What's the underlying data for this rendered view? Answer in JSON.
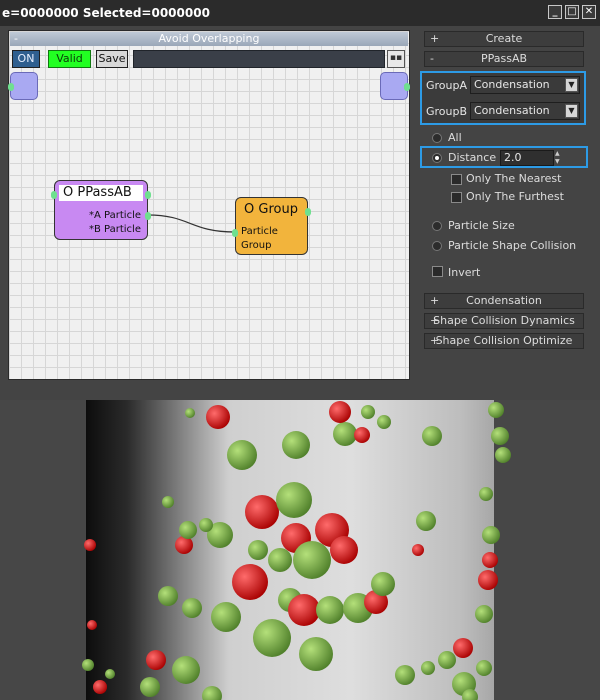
{
  "window": {
    "title": "e=0000000  Selected=0000000",
    "buttons": {
      "minimize": "_",
      "maximize": "□",
      "close": "✕"
    }
  },
  "graph": {
    "header_title": "Avoid Overlapping",
    "header_toggle": "-",
    "toolbar": {
      "on_label": "ON",
      "valid_label": "Valid",
      "save_label": "Save",
      "dots_label": "▪▪"
    },
    "nodes": {
      "ppass": {
        "title": "O PPassAB",
        "ports": [
          "*A Particle",
          "*B Particle"
        ]
      },
      "group": {
        "title": "O Group",
        "ports": [
          "Particle",
          "Group"
        ]
      }
    },
    "colors": {
      "ppass_node": "#c889f2",
      "group_node": "#f2b43c",
      "valid": "#22ff22"
    }
  },
  "panel": {
    "create_label": "Create",
    "create_sign": "+",
    "ppass_label": "PPassAB",
    "ppass_sign": "-",
    "groupA_label": "GroupA",
    "groupA_value": "Condensation",
    "groupB_label": "GroupB",
    "groupB_value": "Condensation",
    "options": {
      "all": "All",
      "distance": "Distance",
      "distance_value": "2.0",
      "only_nearest": "Only The Nearest",
      "only_furthest": "Only The Furthest",
      "particle_size": "Particle Size",
      "particle_shape_collision": "Particle Shape Collision",
      "invert": "Invert"
    },
    "rollouts": [
      {
        "sign": "+",
        "label": "Condensation"
      },
      {
        "sign": "+",
        "label": "Shape Collision Dynamics"
      },
      {
        "sign": "+",
        "label": "Shape Collision Optimize"
      }
    ],
    "accent_color": "#2d9be6"
  },
  "viewport": {
    "colors": {
      "green_particle": "#7ab24a",
      "red_particle": "#e21a1a",
      "cylinder": "#d8d8d8",
      "background": "#474747"
    }
  }
}
